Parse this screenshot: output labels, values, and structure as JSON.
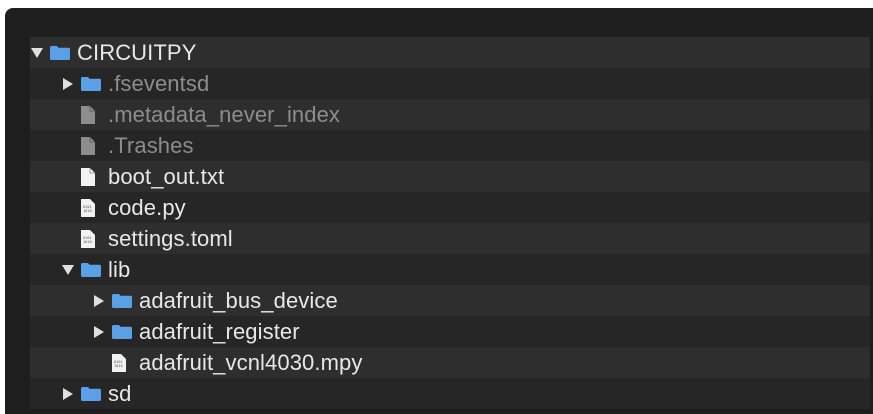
{
  "tree": {
    "items": [
      {
        "label": "CIRCUITPY",
        "depth": 0,
        "kind": "folder",
        "state": "open",
        "dim": false
      },
      {
        "label": ".fseventsd",
        "depth": 1,
        "kind": "folder",
        "state": "closed",
        "dim": true
      },
      {
        "label": ".metadata_never_index",
        "depth": 1,
        "kind": "file",
        "state": "none",
        "dim": true
      },
      {
        "label": ".Trashes",
        "depth": 1,
        "kind": "file",
        "state": "none",
        "dim": true
      },
      {
        "label": "boot_out.txt",
        "depth": 1,
        "kind": "file",
        "state": "none",
        "dim": false
      },
      {
        "label": "code.py",
        "depth": 1,
        "kind": "binary-file",
        "state": "none",
        "dim": false
      },
      {
        "label": "settings.toml",
        "depth": 1,
        "kind": "binary-file",
        "state": "none",
        "dim": false
      },
      {
        "label": "lib",
        "depth": 1,
        "kind": "folder",
        "state": "open",
        "dim": false
      },
      {
        "label": "adafruit_bus_device",
        "depth": 2,
        "kind": "folder",
        "state": "closed",
        "dim": false
      },
      {
        "label": "adafruit_register",
        "depth": 2,
        "kind": "folder",
        "state": "closed",
        "dim": false
      },
      {
        "label": "adafruit_vcnl4030.mpy",
        "depth": 2,
        "kind": "binary-file",
        "state": "none",
        "dim": false
      },
      {
        "label": "sd",
        "depth": 1,
        "kind": "folder",
        "state": "closed",
        "dim": false
      }
    ]
  },
  "colors": {
    "folder": "#5aa0e6",
    "file": "#f2f2f2",
    "file_dim": "#8d8d8d",
    "text": "#e8e8e8",
    "text_dim": "#8d8d8d",
    "row_odd": "#2e2e2e",
    "row_even": "#262626"
  }
}
